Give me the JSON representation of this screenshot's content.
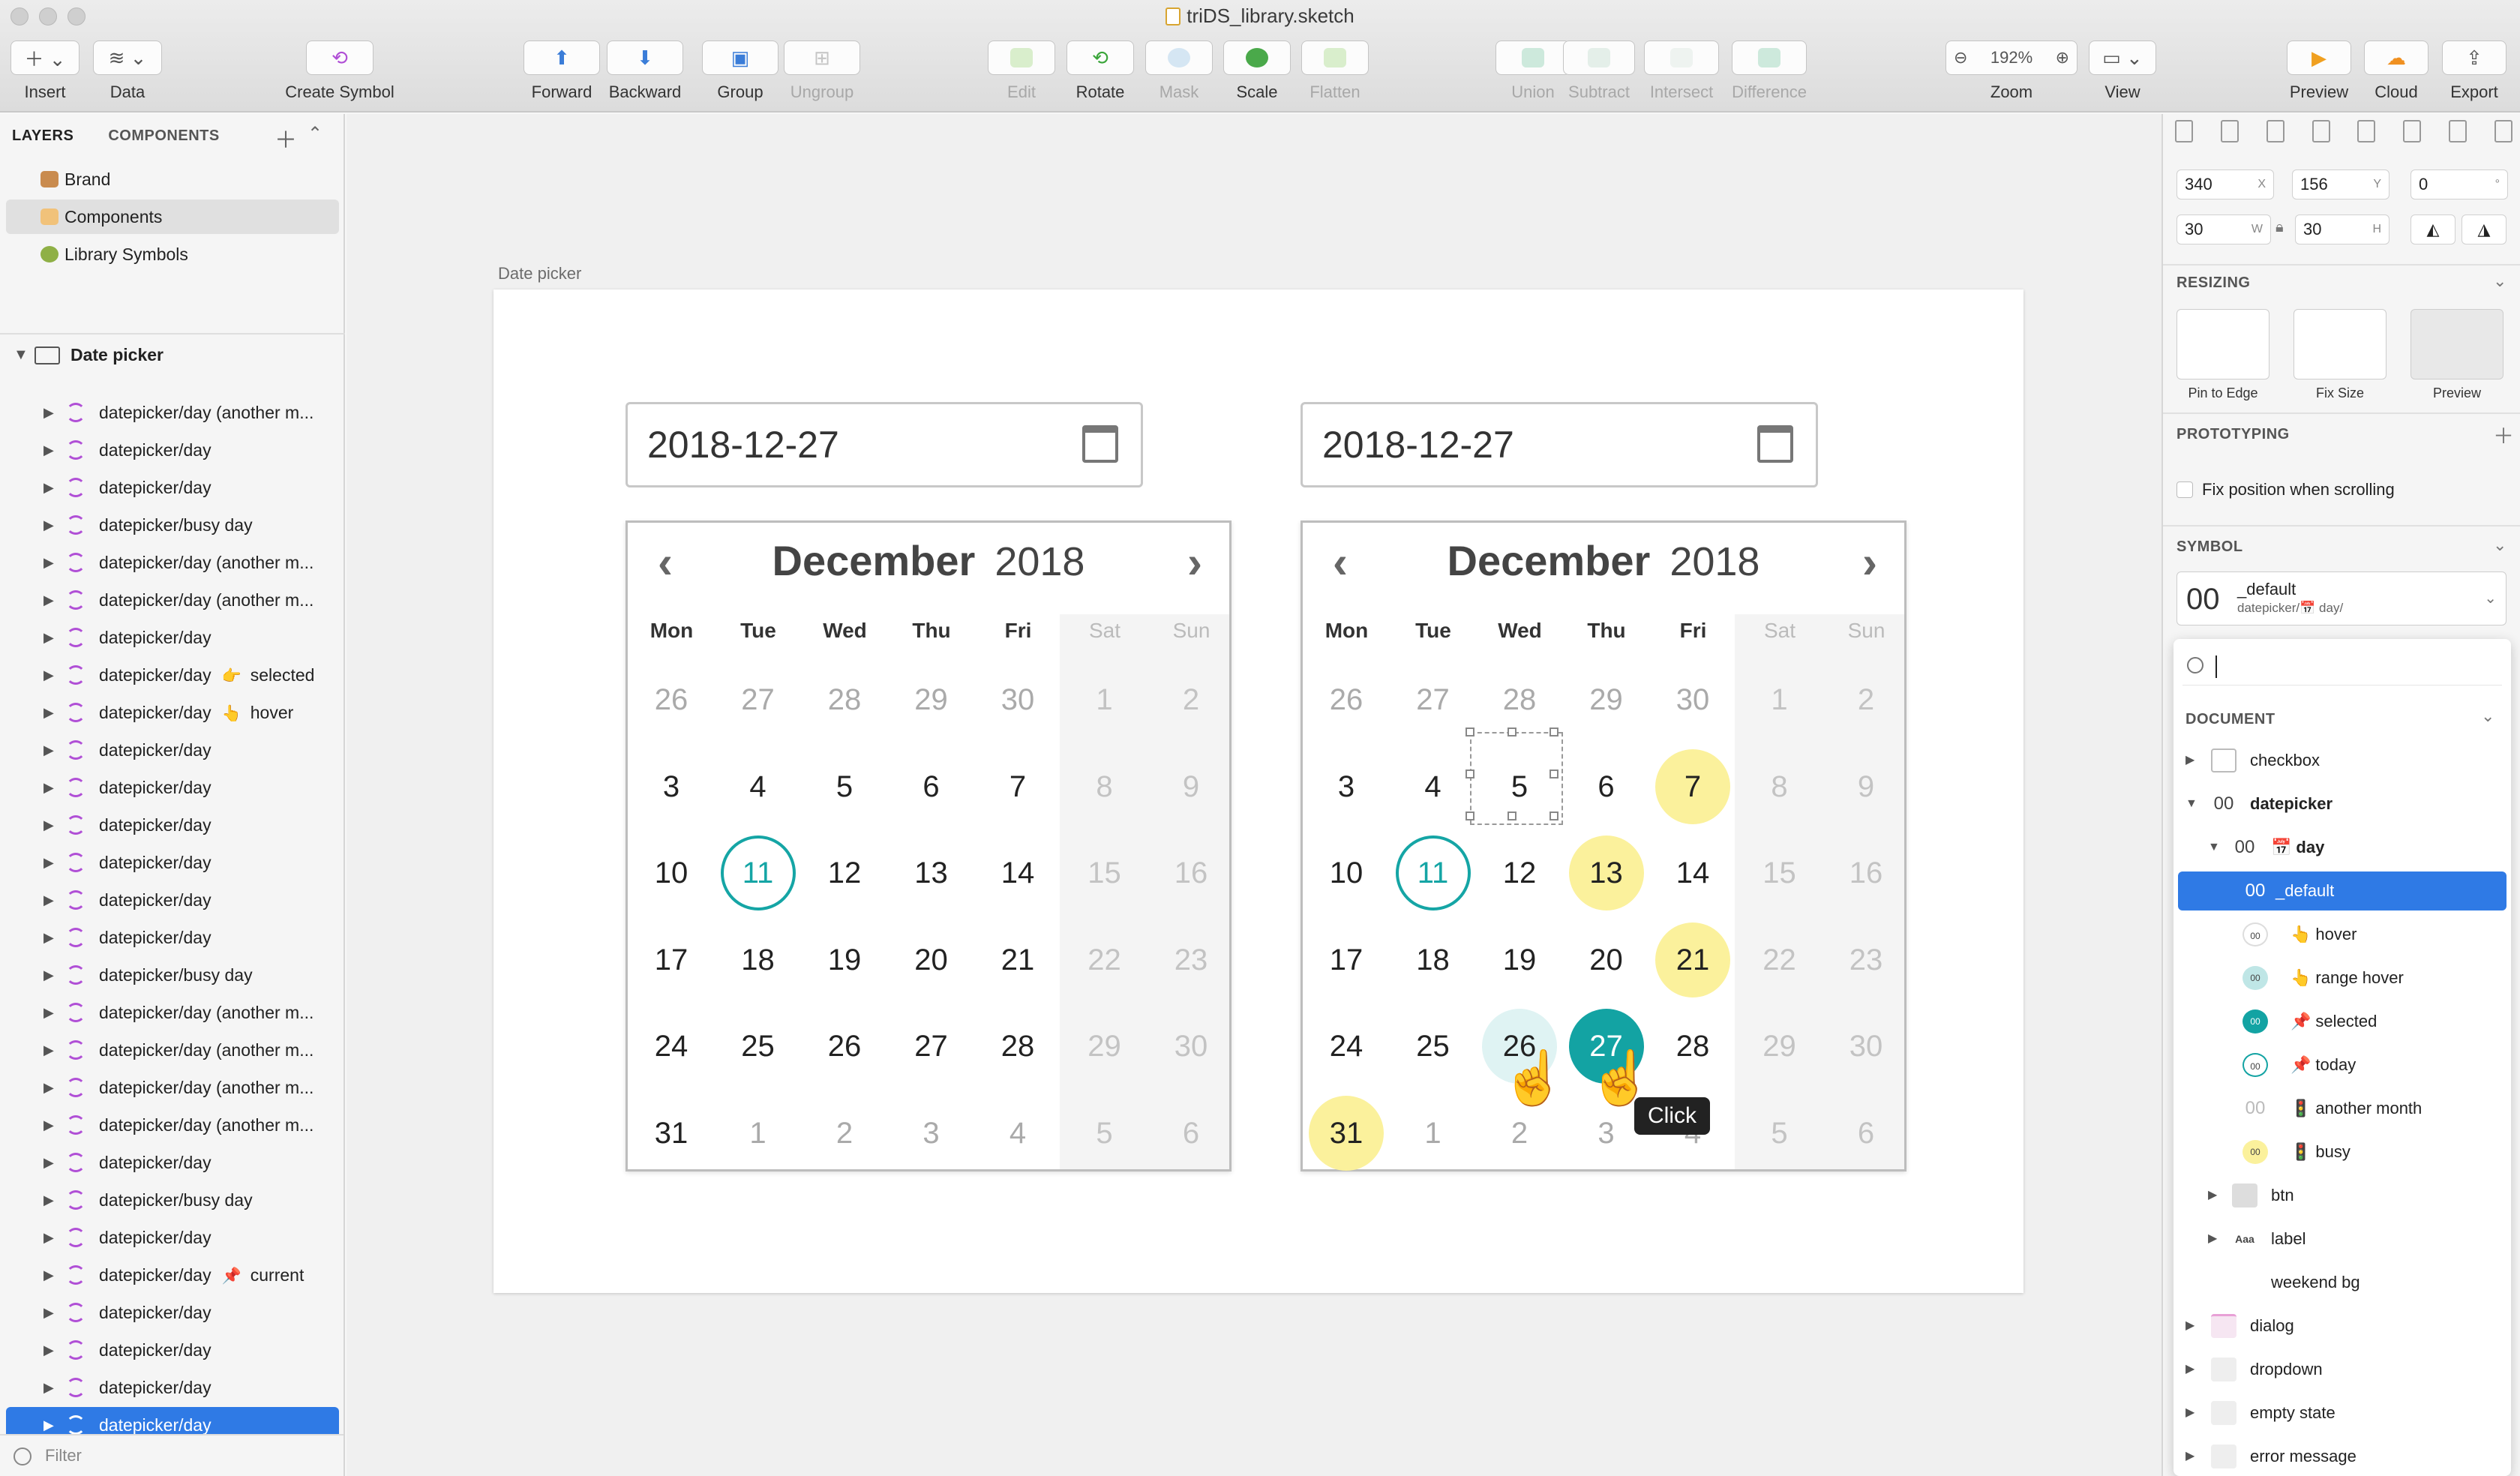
{
  "window": {
    "title": "triDS_library.sketch"
  },
  "toolbar": {
    "insert": "Insert",
    "data": "Data",
    "create_symbol": "Create Symbol",
    "forward": "Forward",
    "backward": "Backward",
    "group": "Group",
    "ungroup": "Ungroup",
    "edit": "Edit",
    "rotate": "Rotate",
    "mask": "Mask",
    "scale": "Scale",
    "flatten": "Flatten",
    "union": "Union",
    "subtract": "Subtract",
    "intersect": "Intersect",
    "difference": "Difference",
    "zoom_value": "192%",
    "zoom": "Zoom",
    "view": "View",
    "preview": "Preview",
    "cloud": "Cloud",
    "export": "Export"
  },
  "left": {
    "tab_layers": "LAYERS",
    "tab_components": "COMPONENTS",
    "pages": [
      {
        "label": "Brand",
        "icon": "palette-icon"
      },
      {
        "label": "Components",
        "icon": "cake-icon"
      },
      {
        "label": "Library Symbols",
        "icon": "avocado-icon"
      }
    ],
    "artboard": "Date picker",
    "layers": [
      {
        "label": "datepicker/day (another m..."
      },
      {
        "label": "datepicker/day"
      },
      {
        "label": "datepicker/day"
      },
      {
        "label": "datepicker/busy day"
      },
      {
        "label": "datepicker/day (another m..."
      },
      {
        "label": "datepicker/day (another m..."
      },
      {
        "label": "datepicker/day"
      },
      {
        "label": "datepicker/day",
        "emoji": "👉",
        "suffix": "selected"
      },
      {
        "label": "datepicker/day",
        "emoji": "👆",
        "suffix": "hover"
      },
      {
        "label": "datepicker/day"
      },
      {
        "label": "datepicker/day"
      },
      {
        "label": "datepicker/day"
      },
      {
        "label": "datepicker/day"
      },
      {
        "label": "datepicker/day"
      },
      {
        "label": "datepicker/day"
      },
      {
        "label": "datepicker/busy day"
      },
      {
        "label": "datepicker/day (another m..."
      },
      {
        "label": "datepicker/day (another m..."
      },
      {
        "label": "datepicker/day (another m..."
      },
      {
        "label": "datepicker/day (another m..."
      },
      {
        "label": "datepicker/day"
      },
      {
        "label": "datepicker/busy day"
      },
      {
        "label": "datepicker/day"
      },
      {
        "label": "datepicker/day",
        "emoji": "📌",
        "suffix": "current"
      },
      {
        "label": "datepicker/day"
      },
      {
        "label": "datepicker/day"
      },
      {
        "label": "datepicker/day"
      },
      {
        "label": "datepicker/day"
      }
    ],
    "filter": "Filter"
  },
  "canvas": {
    "artboard_label": "Date picker",
    "input_value_1": "2018-12-27",
    "input_value_2": "2018-12-27",
    "month": "December",
    "year": "2018",
    "weekdays": [
      "Mon",
      "Tue",
      "Wed",
      "Thu",
      "Fri",
      "Sat",
      "Sun"
    ],
    "weeks": [
      [
        "26",
        "27",
        "28",
        "29",
        "30",
        "1",
        "2"
      ],
      [
        "3",
        "4",
        "5",
        "6",
        "7",
        "8",
        "9"
      ],
      [
        "10",
        "11",
        "12",
        "13",
        "14",
        "15",
        "16"
      ],
      [
        "17",
        "18",
        "19",
        "20",
        "21",
        "22",
        "23"
      ],
      [
        "24",
        "25",
        "26",
        "27",
        "28",
        "29",
        "30"
      ],
      [
        "31",
        "1",
        "2",
        "3",
        "4",
        "5",
        "6"
      ]
    ],
    "tooltip": "Click",
    "colors": {
      "teal": "#13a3a3",
      "busy": "#fbf19c",
      "range": "#dff3f3"
    }
  },
  "right": {
    "x": "340",
    "y": "156",
    "rotation": "0",
    "w": "30",
    "h": "30",
    "x_label": "X",
    "y_label": "Y",
    "w_label": "W",
    "h_label": "H",
    "deg": "°",
    "resizing": "RESIZING",
    "pin_to_edge": "Pin to Edge",
    "fix_size": "Fix Size",
    "preview": "Preview",
    "prototyping": "PROTOTYPING",
    "fix_position": "Fix position when scrolling",
    "symbol": "SYMBOL",
    "symbol_num": "00",
    "symbol_name": "_default",
    "symbol_path": "datepicker/📅 day/",
    "document": "DOCUMENT",
    "tree": {
      "checkbox": "checkbox",
      "datepicker": "datepicker",
      "day": "day",
      "default": "_default",
      "hover": "hover",
      "range_hover": "range hover",
      "selected": "selected",
      "today": "today",
      "another_month": "another month",
      "busy": "busy",
      "btn": "btn",
      "label": "label",
      "weekend_bg": "weekend bg",
      "dialog": "dialog",
      "dropdown": "dropdown",
      "empty_state": "empty state",
      "error_message": "error message",
      "num": "00",
      "aaa": "Aaa"
    }
  }
}
